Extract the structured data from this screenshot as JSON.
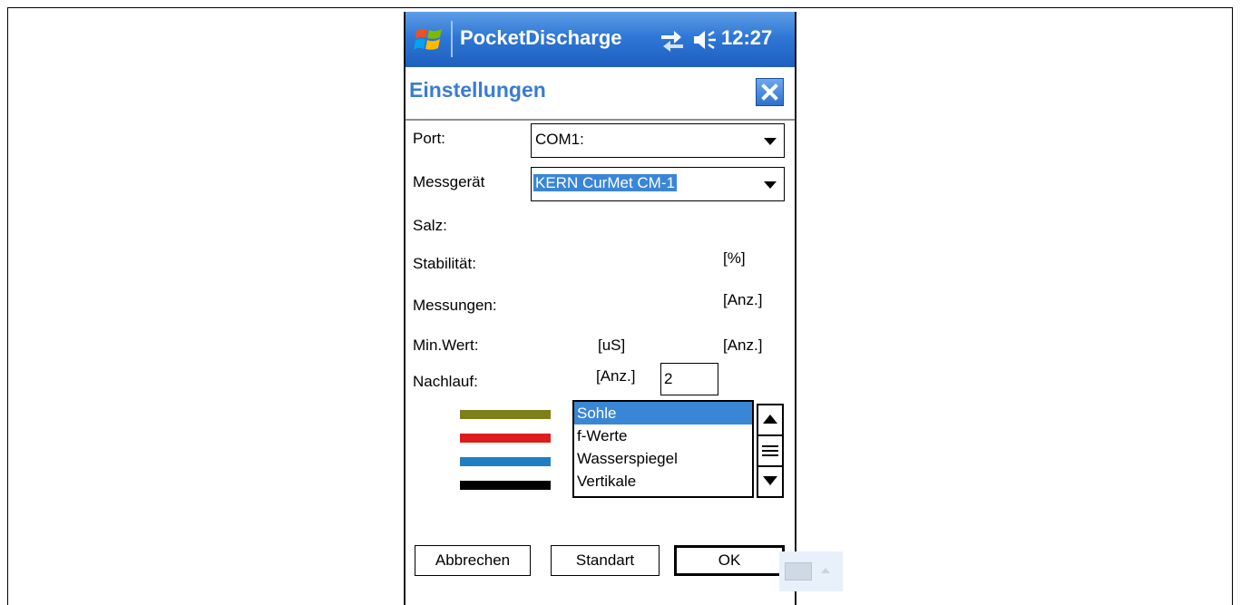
{
  "titlebar": {
    "app_title": "PocketDischarge",
    "clock": "12:27"
  },
  "dialog": {
    "title": "Einstellungen"
  },
  "form": {
    "port_label": "Port:",
    "port_value": "COM1:",
    "device_label": "Messgerät",
    "device_value": "KERN CurMet CM-1",
    "salt_label": "Salz:",
    "stability_label": "Stabilität:",
    "stability_unit": "[%]",
    "measurements_label": "Messungen:",
    "measurements_unit": "[Anz.]",
    "minvalue_label": "Min.Wert:",
    "minvalue_unit1": "[uS]",
    "minvalue_unit2": "[Anz.]",
    "followup_label": "Nachlauf:",
    "followup_unit": "[Anz.]",
    "followup_value": "2"
  },
  "legend": {
    "items": [
      "Sohle",
      "f-Werte",
      "Wasserspiegel",
      "Vertikale"
    ],
    "selected_index": 0,
    "colors": [
      "#7f7f1a",
      "#e01b1b",
      "#1f7fc4",
      "#000000"
    ]
  },
  "buttons": {
    "cancel": "Abbrechen",
    "default": "Standart",
    "ok": "OK"
  },
  "icons": {
    "start": "windows-flag-icon",
    "connectivity": "connectivity-icon",
    "volume": "volume-icon",
    "close": "close-icon",
    "keyboard": "keyboard-icon"
  }
}
